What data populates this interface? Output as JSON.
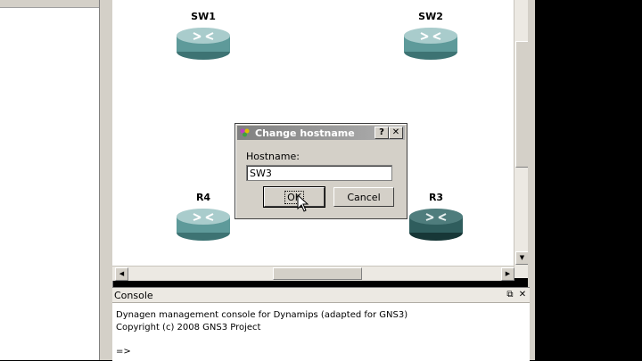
{
  "devices": [
    {
      "id": "sw1",
      "label": "SW1",
      "type": "router",
      "selected": false
    },
    {
      "id": "sw2",
      "label": "SW2",
      "type": "router",
      "selected": false
    },
    {
      "id": "r4",
      "label": "R4",
      "type": "router",
      "selected": false
    },
    {
      "id": "r3",
      "label": "R3",
      "type": "router",
      "selected": true
    }
  ],
  "dialog": {
    "title": "Change hostname",
    "help_button": "?",
    "close_button": "✕",
    "field_label": "Hostname:",
    "field_value": "SW3",
    "ok_label": "OK",
    "cancel_label": "Cancel"
  },
  "console": {
    "title": "Console",
    "lines": [
      "Dynagen management console for Dynamips (adapted for GNS3)",
      "Copyright (c) 2008 GNS3 Project",
      "",
      "=>"
    ]
  },
  "colors": {
    "router_fill": "#5e9a9a",
    "router_selected_fill": "#2f5d5d",
    "frame": "#d4d0c8"
  }
}
